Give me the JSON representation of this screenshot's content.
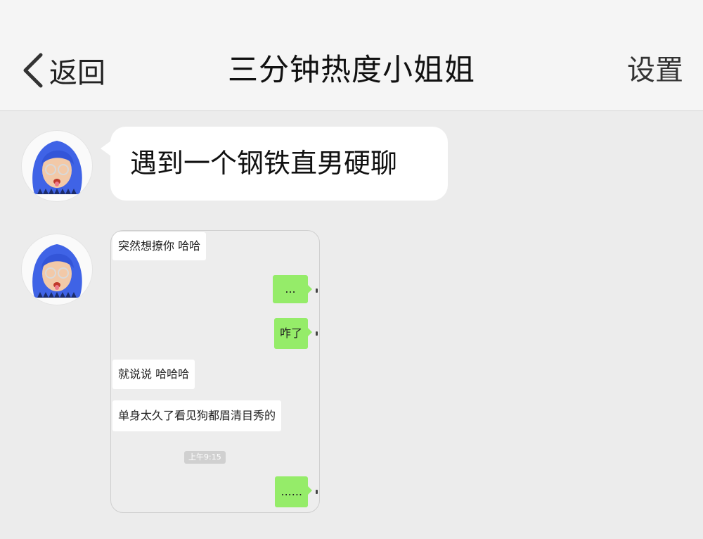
{
  "header": {
    "back_label": "返回",
    "title": "三分钟热度小姐姐",
    "settings_label": "设置"
  },
  "messages": {
    "text_message": "遇到一个钢铁直男硬聊",
    "screenshot": {
      "m1": "突然想撩你 哈哈",
      "m2": "...",
      "m3": "咋了",
      "m4": "就说说 哈哈哈",
      "m5": "单身太久了看见狗都眉清目秀的",
      "time": "上午9:15",
      "m6": "......"
    }
  },
  "colors": {
    "background": "#ececec",
    "navbar": "#f5f5f5",
    "bubble": "#ffffff",
    "wechat_green": "#95ec69",
    "avatar_hair": "#3f63e6"
  }
}
